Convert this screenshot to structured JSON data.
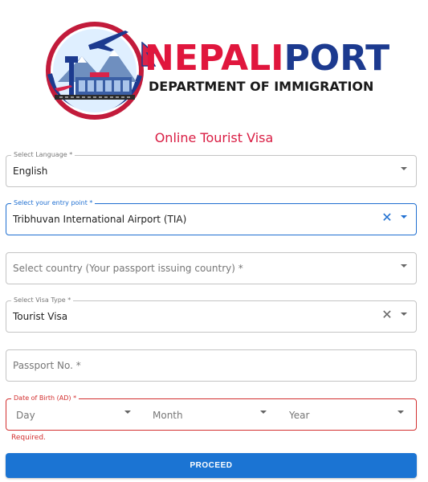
{
  "brand": {
    "title_red": "NEPALI",
    "title_blue": "PORT",
    "subtitle": "DEPARTMENT OF IMMIGRATION"
  },
  "page_title": "Online Tourist Visa",
  "form": {
    "language": {
      "label": "Select Language *",
      "value": "English"
    },
    "entry_point": {
      "label": "Select your entry point *",
      "value": "Tribhuvan International Airport (TIA)"
    },
    "country": {
      "placeholder": "Select country (Your passport issuing country) *"
    },
    "visa_type": {
      "label": "Select Visa Type *",
      "value": "Tourist Visa"
    },
    "passport": {
      "placeholder": "Passport No. *"
    },
    "dob": {
      "label": "Date of Birth (AD) *",
      "day_placeholder": "Day",
      "month_placeholder": "Month",
      "year_placeholder": "Year",
      "error": "Required."
    },
    "proceed_label": "PROCEED"
  },
  "icons": {
    "clear": "close-icon",
    "dropdown": "chevron-down-icon"
  },
  "colors": {
    "brand_red": "#e0163d",
    "brand_blue": "#1c3a8f",
    "accent_blue": "#1b74d3",
    "error_red": "#d32f2f"
  }
}
